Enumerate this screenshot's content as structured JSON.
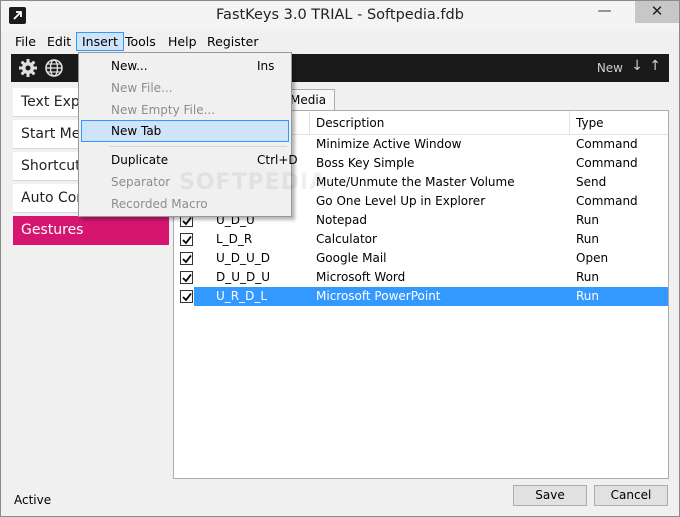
{
  "window": {
    "title": "FastKeys 3.0 TRIAL - Softpedia.fdb",
    "controls": {
      "minimize": "—",
      "maximize": "☐",
      "close": "✕"
    }
  },
  "menubar": {
    "items": [
      "File",
      "Edit",
      "Insert",
      "Tools",
      "Help",
      "Register"
    ],
    "active": "Insert"
  },
  "toolbar": {
    "icons": [
      "gear-icon",
      "globe-icon"
    ],
    "new_label": "New",
    "down_arrow": "↓",
    "up_arrow": "↑"
  },
  "sidebar": {
    "items": [
      {
        "label": "Text Expander"
      },
      {
        "label": "Start Menu"
      },
      {
        "label": "Shortcuts"
      },
      {
        "label": "Auto Complete"
      },
      {
        "label": "Gestures"
      }
    ],
    "selected": "Gestures"
  },
  "tabs": {
    "visible_fragment": "Media"
  },
  "table": {
    "columns": [
      "",
      "Description",
      "Type"
    ],
    "rows": [
      {
        "checked": true,
        "gesture": "",
        "description": "Minimize Active Window",
        "type": "Command"
      },
      {
        "checked": true,
        "gesture": "",
        "description": "Boss Key Simple",
        "type": "Command"
      },
      {
        "checked": true,
        "gesture": "",
        "description": "Mute/Unmute the Master Volume",
        "type": "Send"
      },
      {
        "checked": true,
        "gesture": "",
        "description": "Go One Level Up in Explorer",
        "type": "Command"
      },
      {
        "checked": true,
        "gesture": "U_D_U",
        "description": "Notepad",
        "type": "Run"
      },
      {
        "checked": true,
        "gesture": "L_D_R",
        "description": "Calculator",
        "type": "Run"
      },
      {
        "checked": true,
        "gesture": "U_D_U_D",
        "description": "Google Mail",
        "type": "Open"
      },
      {
        "checked": true,
        "gesture": "D_U_D_U",
        "description": "Microsoft Word",
        "type": "Run"
      },
      {
        "checked": true,
        "gesture": "U_R_D_L",
        "description": "Microsoft PowerPoint",
        "type": "Run",
        "selected": true
      }
    ]
  },
  "insert_menu": {
    "items": [
      {
        "label": "New...",
        "shortcut": "Ins",
        "enabled": true
      },
      {
        "label": "New File...",
        "shortcut": "",
        "enabled": false
      },
      {
        "label": "New Empty File...",
        "shortcut": "",
        "enabled": false
      },
      {
        "label": "New Tab",
        "shortcut": "",
        "enabled": true,
        "hover": true
      },
      {
        "label": "Duplicate",
        "shortcut": "Ctrl+D",
        "enabled": true
      },
      {
        "label": "Separator",
        "shortcut": "",
        "enabled": false
      },
      {
        "label": "Recorded Macro",
        "shortcut": "",
        "enabled": false
      }
    ],
    "watermark": "SOFTPEDIA"
  },
  "statusbar": {
    "status": "Active",
    "save_label": "Save",
    "cancel_label": "Cancel"
  },
  "colors": {
    "accent_selected_sidebar": "#d5156f",
    "row_selected": "#3399ff",
    "toolbar_bg": "#1a1a1a",
    "menu_hover": "#cfe4f8"
  }
}
